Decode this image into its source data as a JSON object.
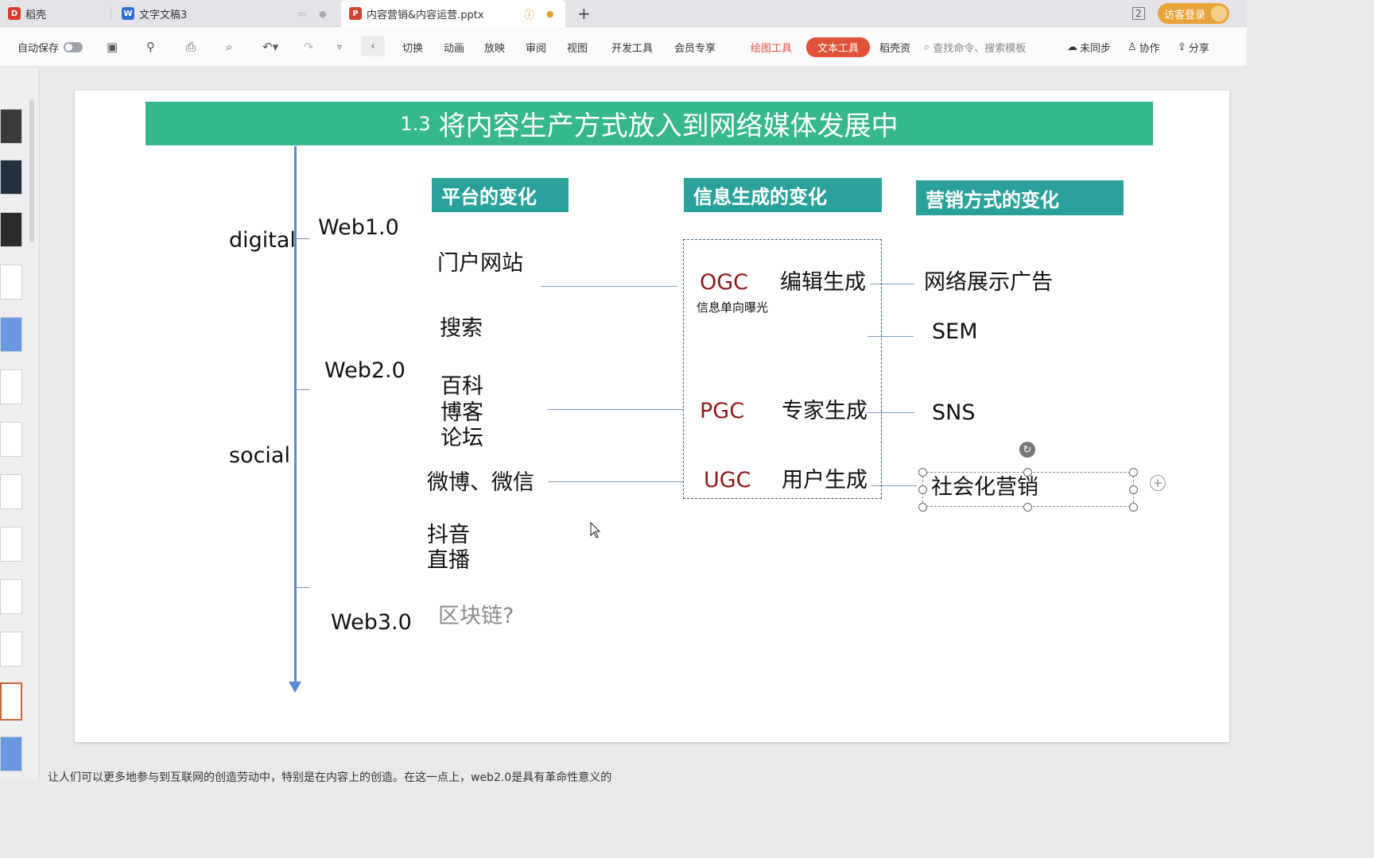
{
  "tabs": [
    {
      "label": "稻壳",
      "icon": "daoke-icon",
      "color": "#d8392b"
    },
    {
      "label": "文字文稿3",
      "icon": "word-icon",
      "color": "#2f6fd6"
    },
    {
      "label": "内容营销&内容运营.pptx",
      "icon": "ppt-icon",
      "color": "#d0452e"
    }
  ],
  "window": {
    "page_count": "2",
    "login": "访客登录"
  },
  "toolbar": {
    "autosave": "自动保存",
    "menus": [
      "切换",
      "动画",
      "放映",
      "审阅",
      "视图",
      "开发工具",
      "会员专享"
    ],
    "draw_tool": "绘图工具",
    "text_tool": "文本工具",
    "daoke": "稻壳资",
    "search": "查找命令、搜索模板",
    "sync": "未同步",
    "collab": "协作",
    "share": "分享"
  },
  "slide": {
    "title_num": "1.3",
    "title": "将内容生产方式放入到网络媒体发展中",
    "headers": {
      "platform": "平台的变化",
      "info": "信息生成的变化",
      "marketing": "营销方式的变化"
    },
    "eras": {
      "digital": "digital",
      "social": "social",
      "web1": "Web1.0",
      "web2": "Web2.0",
      "web3": "Web3.0"
    },
    "platforms": {
      "portal": "门户网站",
      "search": "搜索",
      "baike": "百科",
      "blog": "博客",
      "forum": "论坛",
      "weibo": "微博、微信",
      "douyin": "抖音",
      "live": "直播",
      "blockchain": "区块链?"
    },
    "info": {
      "ogc": "OGC",
      "ogc_note": "信息单向曝光",
      "ogc_gen": "编辑生成",
      "pgc": "PGC",
      "pgc_gen": "专家生成",
      "ugc": "UGC",
      "ugc_gen": "用户生成"
    },
    "marketing": {
      "display_ad": "网络展示广告",
      "sem": "SEM",
      "sns": "SNS",
      "social": "社会化营销"
    }
  },
  "note": "让人们可以更多地参与到互联网的创造劳动中，特别是在内容上的创造。在这一点上，web2.0是具有革命性意义的"
}
